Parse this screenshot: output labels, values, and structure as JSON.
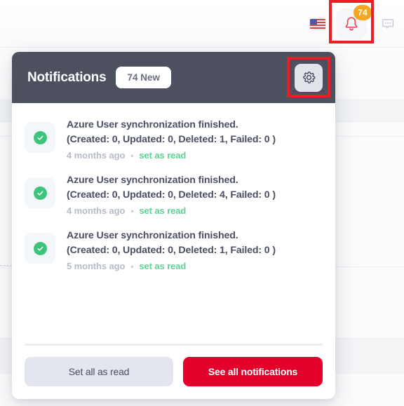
{
  "topbar": {
    "flag_icon": "us-flag-icon",
    "bell_icon": "bell-icon",
    "bell_badge": "74",
    "chat_icon": "chat-bubble-icon"
  },
  "panel": {
    "title": "Notifications",
    "new_badge": "74 New",
    "settings_icon": "gear-icon",
    "items": [
      {
        "status_icon": "check-circle-icon",
        "line1": "Azure User synchronization finished.",
        "line2": "(Created: 0, Updated: 0, Deleted: 1, Failed: 0 )",
        "time": "4 months ago",
        "separator": "•",
        "action": "set as read"
      },
      {
        "status_icon": "check-circle-icon",
        "line1": "Azure User synchronization finished.",
        "line2": "(Created: 0, Updated: 0, Deleted: 4, Failed: 0 )",
        "time": "4 months ago",
        "separator": "•",
        "action": "set as read"
      },
      {
        "status_icon": "check-circle-icon",
        "line1": "Azure User synchronization finished.",
        "line2": "(Created: 0, Updated: 0, Deleted: 1, Failed: 0 )",
        "time": "5 months ago",
        "separator": "•",
        "action": "set as read"
      }
    ],
    "footer": {
      "set_all_label": "Set all as read",
      "see_all_label": "See all notifications"
    }
  },
  "colors": {
    "header_bg": "#4c505f",
    "primary": "#e3002b",
    "badge_orange": "#f5a623",
    "success_green": "#3cc47c",
    "link_green": "#5fd195",
    "highlight_red": "#ee1c25"
  }
}
